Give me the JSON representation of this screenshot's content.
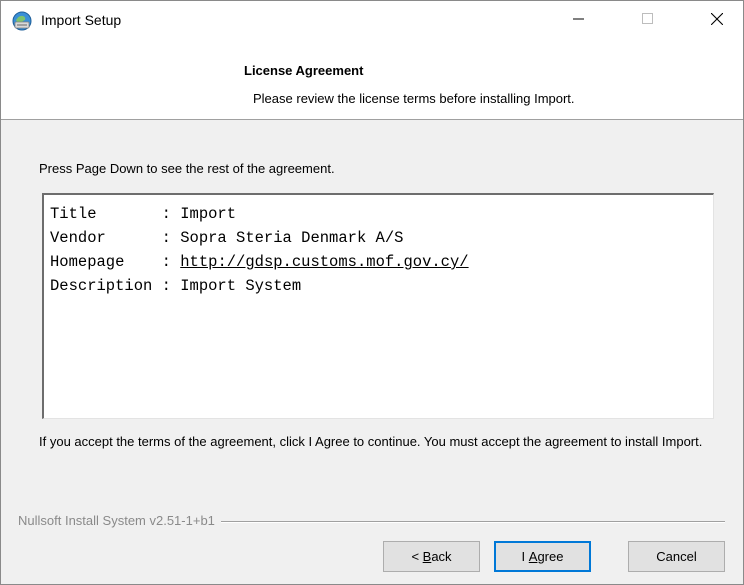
{
  "window": {
    "title": "Import Setup",
    "icon": "installer-globe-icon",
    "controls": {
      "minimize": "minimize-icon",
      "maximize": "maximize-icon",
      "close": "close-icon"
    }
  },
  "header": {
    "title": "License Agreement",
    "subtitle": "Please review the license terms before installing Import."
  },
  "body": {
    "intro": "Press Page Down to see the rest of the agreement.",
    "license_lines": [
      {
        "text": "Title       : Import"
      },
      {
        "text": "Vendor      : Sopra Steria Denmark A/S"
      },
      {
        "prefix": "Homepage    : ",
        "link": "http://gdsp.customs.mof.gov.cy/"
      },
      {
        "text": "Description : Import System"
      }
    ],
    "accept_text": "If you accept the terms of the agreement, click I Agree to continue. You must accept the agreement to install Import."
  },
  "footer": {
    "branding": "Nullsoft Install System v2.51-1+b1",
    "buttons": {
      "back": {
        "prefix": "< ",
        "label": "Back"
      },
      "agree": {
        "prefix": "I ",
        "label": "Agree"
      },
      "cancel": "Cancel"
    }
  },
  "colors": {
    "accent": "#0078d7",
    "dialog_bg": "#f0f0f0",
    "header_bg": "#ffffff",
    "disabled_text": "#8a8a8a"
  }
}
